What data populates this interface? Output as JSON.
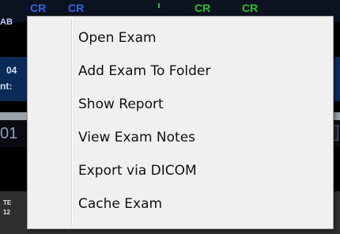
{
  "background": {
    "top_labels": [
      "CR",
      "CR",
      "CR",
      "CR"
    ],
    "left_label_top": "AB",
    "band_num": "04",
    "band_text": "nt:",
    "row_left": "01",
    "bottom_te": "TE",
    "bottom_num": "12"
  },
  "context_menu": {
    "items": [
      {
        "label": "Open Exam"
      },
      {
        "label": "Add Exam To Folder"
      },
      {
        "label": "Show Report"
      },
      {
        "label": "View Exam Notes"
      },
      {
        "label": "Export via DICOM"
      },
      {
        "label": "Cache Exam"
      }
    ]
  },
  "colors": {
    "menu_bg": "#f0f0f0",
    "menu_border": "#9f9f9f",
    "text": "#111111",
    "label_blue": "#2f66e8",
    "label_green": "#23c12b"
  }
}
